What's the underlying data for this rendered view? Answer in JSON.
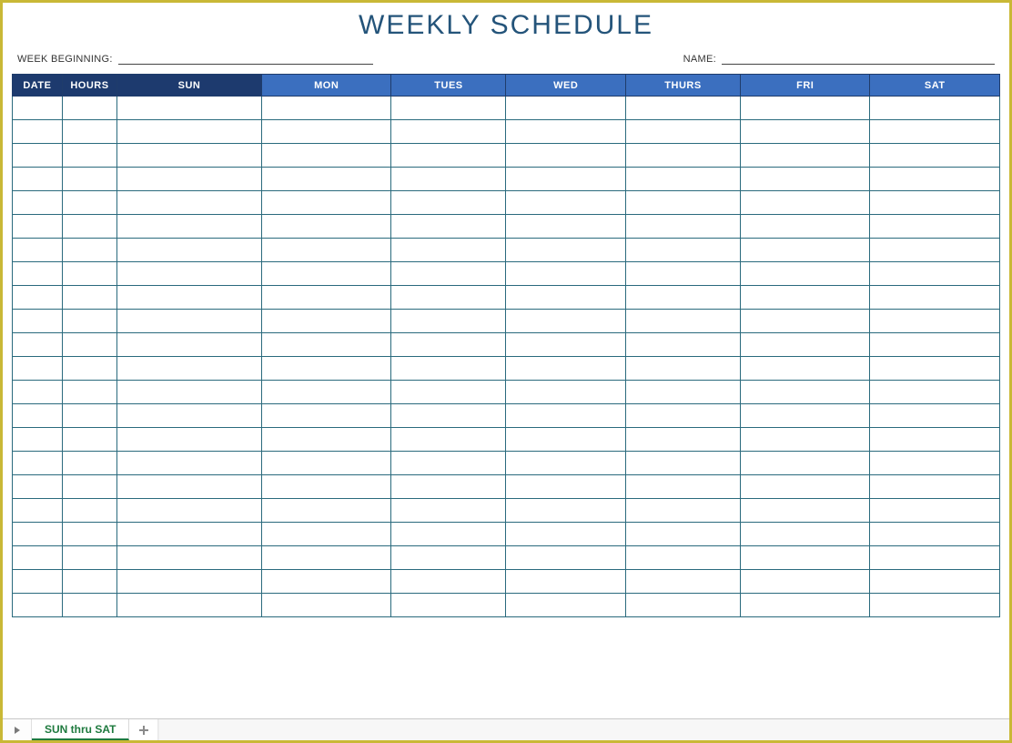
{
  "title": "WEEKLY SCHEDULE",
  "meta": {
    "week_beginning_label": "WEEK BEGINNING:",
    "name_label": "NAME:"
  },
  "table": {
    "headers": {
      "date": "DATE",
      "hours": "HOURS",
      "sun": "SUN",
      "mon": "MON",
      "tues": "TUES",
      "wed": "WED",
      "thurs": "THURS",
      "fri": "FRI",
      "sat": "SAT"
    },
    "row_count": 22
  },
  "tabs": {
    "active": "SUN thru SAT"
  }
}
